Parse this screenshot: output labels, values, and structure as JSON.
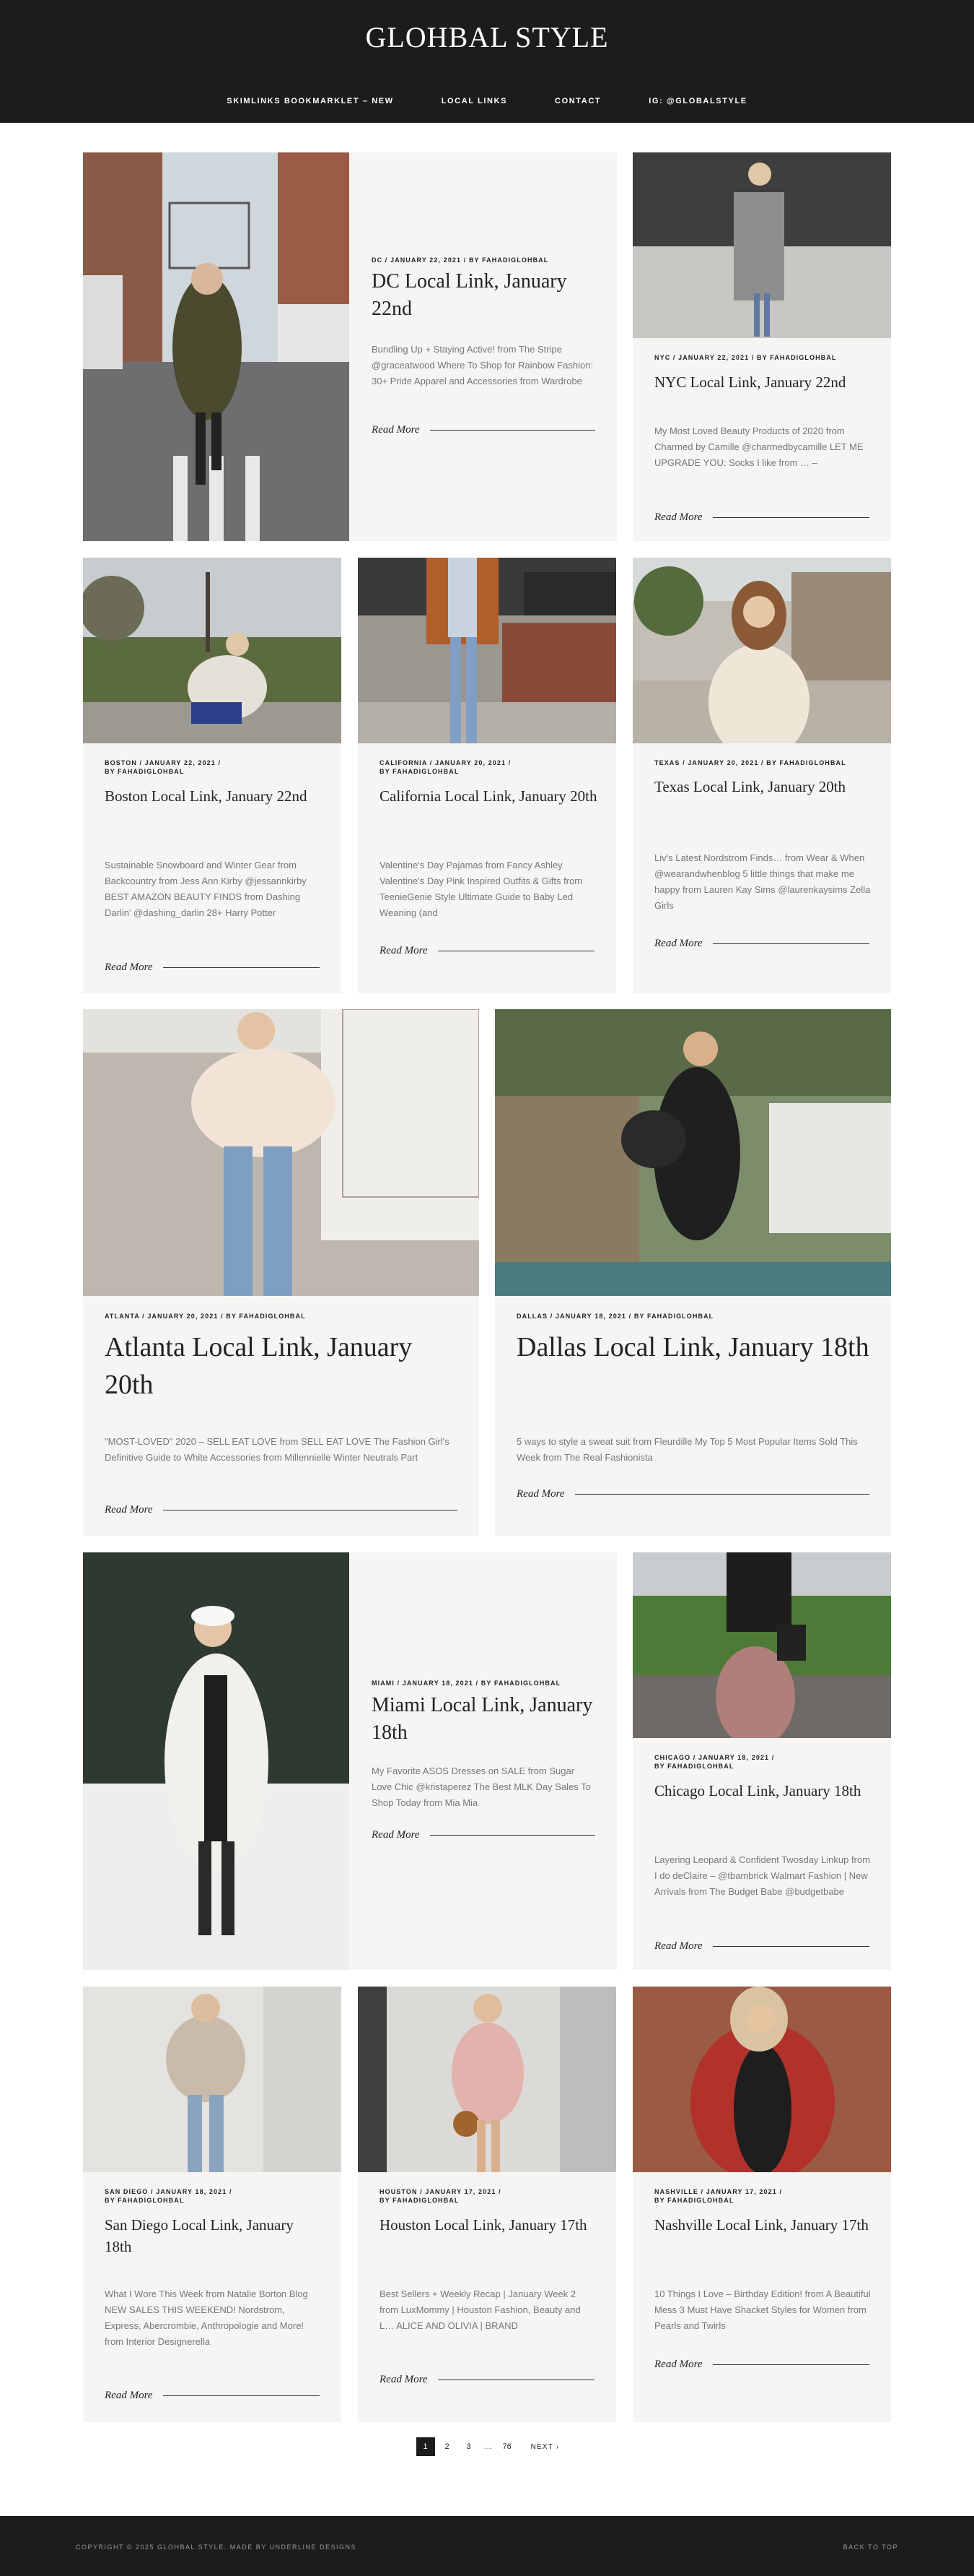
{
  "site": {
    "title": "GLOHBAL STYLE",
    "nav": [
      "SKIMLINKS BOOKMARKLET – NEW",
      "LOCAL LINKS",
      "CONTACT",
      "IG: @GLOBALSTYLE"
    ]
  },
  "posts": [
    {
      "meta_line1": "DC / JANUARY 22, 2021 /  BY FAHADIGLOHBAL",
      "meta_line2": "",
      "title": "DC Local Link, January 22nd",
      "excerpt": "Bundling Up + Staying Active! from The Stripe @graceatwood Where To Shop for Rainbow Fashion: 30+ Pride Apparel and Accessories from Wardrobe",
      "read_more": "Read More"
    },
    {
      "meta_line1": "NYC / JANUARY 22, 2021 /  BY FAHADIGLOHBAL",
      "meta_line2": "",
      "title": "NYC Local Link, January 22nd",
      "excerpt": "My Most Loved Beauty Products of 2020 from Charmed by Camille @charmedbycamille LET ME UPGRADE YOU: Socks I like from … –",
      "read_more": "Read More"
    },
    {
      "meta_line1": "BOSTON / JANUARY 22, 2021 /",
      "meta_line2": "BY FAHADIGLOHBAL",
      "title": "Boston Local Link, January 22nd",
      "excerpt": "Sustainable Snowboard and Winter Gear from Backcountry from Jess Ann Kirby @jessannkirby BEST AMAZON BEAUTY FINDS from Dashing Darlin' @dashing_darlin 28+ Harry Potter",
      "read_more": "Read More"
    },
    {
      "meta_line1": "CALIFORNIA / JANUARY 20, 2021 /",
      "meta_line2": "BY FAHADIGLOHBAL",
      "title": "California Local Link, January 20th",
      "excerpt": "Valentine's Day Pajamas from Fancy Ashley Valentine's Day Pink Inspired Outfits & Gifts from TeenieGenie Style Ultimate Guide to Baby Led Weaning (and",
      "read_more": "Read More"
    },
    {
      "meta_line1": "TEXAS / JANUARY 20, 2021 /  BY FAHADIGLOHBAL",
      "meta_line2": "",
      "title": "Texas Local Link, January 20th",
      "excerpt": "Liv's Latest Nordstrom Finds… from Wear & When @wearandwhenblog 5 little things that make me happy from Lauren Kay Sims @laurenkaysims Zella Girls",
      "read_more": "Read More"
    },
    {
      "meta_line1": "ATLANTA / JANUARY 20, 2021 /  BY FAHADIGLOHBAL",
      "meta_line2": "",
      "title": "Atlanta Local Link, January 20th",
      "excerpt": "\"MOST-LOVED\" 2020 – SELL EAT LOVE from SELL EAT LOVE The Fashion Girl's Definitive Guide to White Accessories from Millennielle Winter Neutrals Part",
      "read_more": "Read More"
    },
    {
      "meta_line1": "DALLAS / JANUARY 18, 2021 /  BY FAHADIGLOHBAL",
      "meta_line2": "",
      "title": "Dallas Local Link, January 18th",
      "excerpt": "5 ways to style a sweat suit from Fleurdille My Top 5 Most Popular Items Sold This Week from The Real Fashionista",
      "read_more": "Read More"
    },
    {
      "meta_line1": "MIAMI / JANUARY 18, 2021 /  BY FAHADIGLOHBAL",
      "meta_line2": "",
      "title": "Miami Local Link, January 18th",
      "excerpt": "My Favorite ASOS Dresses on SALE from Sugar Love Chic @kristaperez The Best MLK Day Sales To Shop Today from Mia Mia",
      "read_more": "Read More"
    },
    {
      "meta_line1": "CHICAGO / JANUARY 18, 2021 /",
      "meta_line2": "BY FAHADIGLOHBAL",
      "title": "Chicago Local Link, January 18th",
      "excerpt": "Layering Leopard & Confident Twosday Linkup from I do deClaire – @tbambrick Walmart Fashion | New Arrivals from The Budget Babe @budgetbabe",
      "read_more": "Read More"
    },
    {
      "meta_line1": "SAN DIEGO / JANUARY 18, 2021 /",
      "meta_line2": "BY FAHADIGLOHBAL",
      "title": "San Diego Local Link, January 18th",
      "excerpt": "What I Wore This Week from Natalie Borton Blog NEW SALES THIS WEEKEND! Nordstrom, Express, Abercrombie, Anthropologie and More! from Interior Designerella",
      "read_more": "Read More"
    },
    {
      "meta_line1": "HOUSTON / JANUARY 17, 2021 /",
      "meta_line2": "BY FAHADIGLOHBAL",
      "title": "Houston Local Link, January 17th",
      "excerpt": "Best Sellers + Weekly Recap | January Week 2 from LuxMommy | Houston Fashion, Beauty and L… ALICE AND OLIVIA | BRAND",
      "read_more": "Read More"
    },
    {
      "meta_line1": "NASHVILLE / JANUARY 17, 2021 /",
      "meta_line2": "BY FAHADIGLOHBAL",
      "title": "Nashville Local Link, January 17th",
      "excerpt": "10 Things I Love – Birthday Edition! from A Beautiful Mess 3 Must Have Shacket Styles for Women from Pearls and Twirls",
      "read_more": "Read More"
    }
  ],
  "pagination": {
    "pages": [
      "1",
      "2",
      "3"
    ],
    "dots": "…",
    "last": "76",
    "next": "NEXT ›"
  },
  "footer": {
    "copyright": "COPYRIGHT © 2025 GLOHBAL STYLE. MADE BY UNDERLINE DESIGNS",
    "back_to_top": "BACK TO TOP"
  },
  "colors": {
    "header_bg": "#1c1c1c",
    "card_bg": "#f6f5f3",
    "text": "#222222",
    "muted": "#777777"
  }
}
